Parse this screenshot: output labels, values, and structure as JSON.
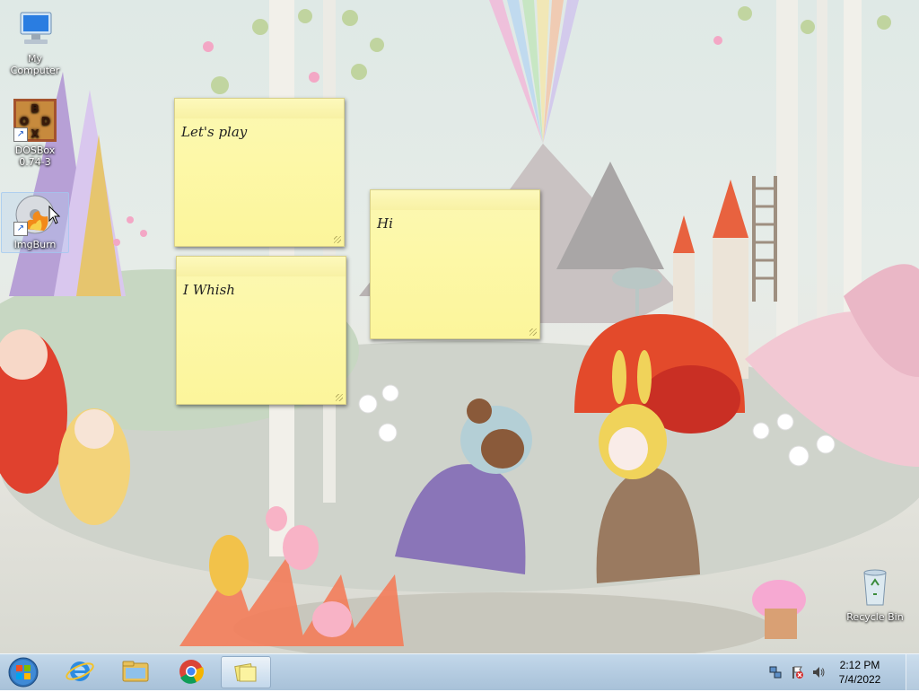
{
  "desktop": {
    "icons": [
      {
        "label": "My Computer"
      },
      {
        "label": "DOSBox\n0.74-3"
      },
      {
        "label": "ImgBurn"
      },
      {
        "label": "Recycle Bin"
      }
    ],
    "dosbox_logo_letters": [
      "B",
      "O",
      "D",
      "X"
    ],
    "notes": [
      {
        "text": "Let's play"
      },
      {
        "text": "Hi"
      },
      {
        "text": "I Whish"
      }
    ]
  },
  "taskbar": {
    "pinned": [
      {
        "icon": "start-orb-icon"
      },
      {
        "icon": "internet-explorer-icon"
      },
      {
        "icon": "file-explorer-icon"
      },
      {
        "icon": "chrome-icon"
      },
      {
        "icon": "sticky-notes-icon"
      }
    ],
    "clock_time": "2:12 PM",
    "clock_date": "7/4/2022"
  }
}
